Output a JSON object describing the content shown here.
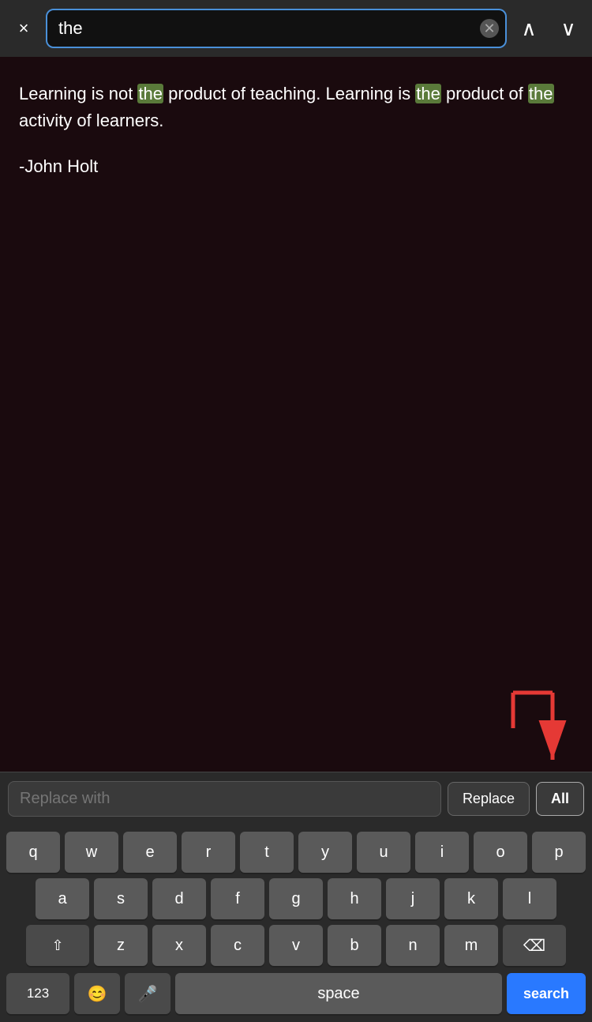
{
  "search_bar": {
    "close_label": "×",
    "search_value": "the",
    "clear_icon": "✕",
    "nav_up": "∧",
    "nav_down": "∨"
  },
  "content": {
    "quote_text_before": "Learning is not ",
    "highlight1": "the",
    "quote_text_middle": " product of teaching. Learning is ",
    "highlight2": "the",
    "quote_text_after": " product of ",
    "highlight3": "the",
    "quote_text_end": " activity of learners.",
    "author": "-John Holt"
  },
  "replace_bar": {
    "placeholder": "Replace with",
    "replace_label": "Replace",
    "replace_all_label": "All"
  },
  "keyboard": {
    "row1": [
      "q",
      "w",
      "e",
      "r",
      "t",
      "y",
      "u",
      "i",
      "o",
      "p"
    ],
    "row2": [
      "a",
      "s",
      "d",
      "f",
      "g",
      "h",
      "j",
      "k",
      "l"
    ],
    "row3": [
      "z",
      "x",
      "c",
      "v",
      "b",
      "n",
      "m"
    ],
    "numbers_label": "123",
    "space_label": "space",
    "search_label": "search"
  }
}
